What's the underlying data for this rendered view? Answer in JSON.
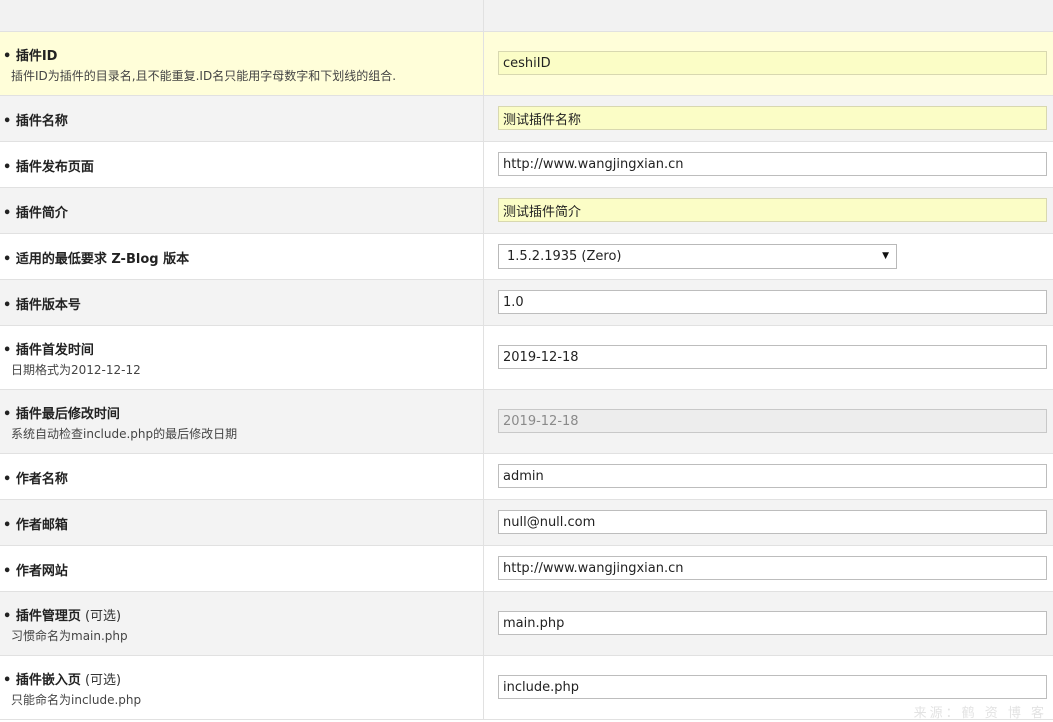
{
  "colors": {
    "highlight_row": "#fffed9",
    "alt_row": "#f3f3f3",
    "highlight_field": "#fbfdc6",
    "readonly_field": "#ededed",
    "border": "#e1e1e1"
  },
  "rows": [
    {
      "label": "• 插件ID",
      "desc": "插件ID为插件的目录名,且不能重复.ID名只能用字母数字和下划线的组合.",
      "value": "ceshiID",
      "field": "input",
      "style": "highlight"
    },
    {
      "label": "• 插件名称",
      "value": "测试插件名称",
      "field": "input",
      "style": "highlight"
    },
    {
      "label": "• 插件发布页面",
      "value": "http://www.wangjingxian.cn",
      "field": "input",
      "style": "normal"
    },
    {
      "label": "• 插件简介",
      "value": "测试插件简介",
      "field": "input",
      "style": "highlight"
    },
    {
      "label": "• 适用的最低要求 Z-Blog 版本",
      "value": "1.5.2.1935 (Zero)",
      "field": "select",
      "style": "normal"
    },
    {
      "label": "• 插件版本号",
      "value": "1.0",
      "field": "input",
      "style": "normal"
    },
    {
      "label": "• 插件首发时间",
      "desc": "日期格式为2012-12-12",
      "value": "2019-12-18",
      "field": "input",
      "style": "normal"
    },
    {
      "label": "• 插件最后修改时间",
      "desc": "系统自动检查include.php的最后修改日期",
      "value": "2019-12-18",
      "field": "input",
      "style": "readonly"
    },
    {
      "label": "• 作者名称",
      "value": "admin",
      "field": "input",
      "style": "normal"
    },
    {
      "label": "• 作者邮箱",
      "value": "null@null.com",
      "field": "input",
      "style": "normal"
    },
    {
      "label": "• 作者网站",
      "value": "http://www.wangjingxian.cn",
      "field": "input",
      "style": "normal"
    },
    {
      "label": "• 插件管理页",
      "label_suffix": " (可选)",
      "desc": "习惯命名为main.php",
      "value": "main.php",
      "field": "input",
      "style": "normal"
    },
    {
      "label": "• 插件嵌入页",
      "label_suffix": " (可选)",
      "desc": "只能命名为include.php",
      "value": "include.php",
      "field": "input",
      "style": "normal"
    }
  ],
  "watermark": "来源：鹤 资 博 客",
  "select_arrow_icon": "triangle-down-icon"
}
